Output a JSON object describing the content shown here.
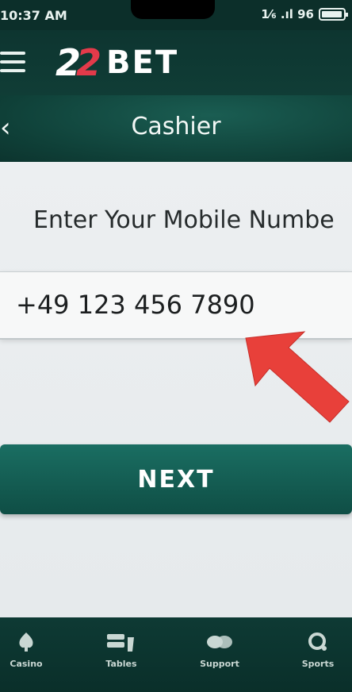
{
  "status_bar": {
    "time": "10:37 AM",
    "indicators": "1⁄₆ .ıl 96",
    "battery_level": 0.96
  },
  "header": {
    "menu_icon": "hamburger-menu-icon",
    "logo_number_1": "2",
    "logo_number_2": "2",
    "logo_text": "BET",
    "brand_colors": {
      "accent": "#e33a4a",
      "primary": "#0f4e45"
    }
  },
  "title_bar": {
    "back_icon": "chevron-left-icon",
    "title": "Cashier"
  },
  "form": {
    "prompt": "Enter Your Mobile Numbe",
    "phone_value": "+49 123 456 7890",
    "next_label": "NEXT"
  },
  "annotation": {
    "arrow_color": "#e8403a",
    "arrow_icon": "arrow-pointer-icon"
  },
  "bottom_nav": {
    "items": [
      {
        "label": "Casino",
        "icon": "casino-icon"
      },
      {
        "label": "Tables",
        "icon": "tables-icon"
      },
      {
        "label": "Support",
        "icon": "support-icon"
      },
      {
        "label": "Sports",
        "icon": "sports-icon"
      }
    ]
  }
}
